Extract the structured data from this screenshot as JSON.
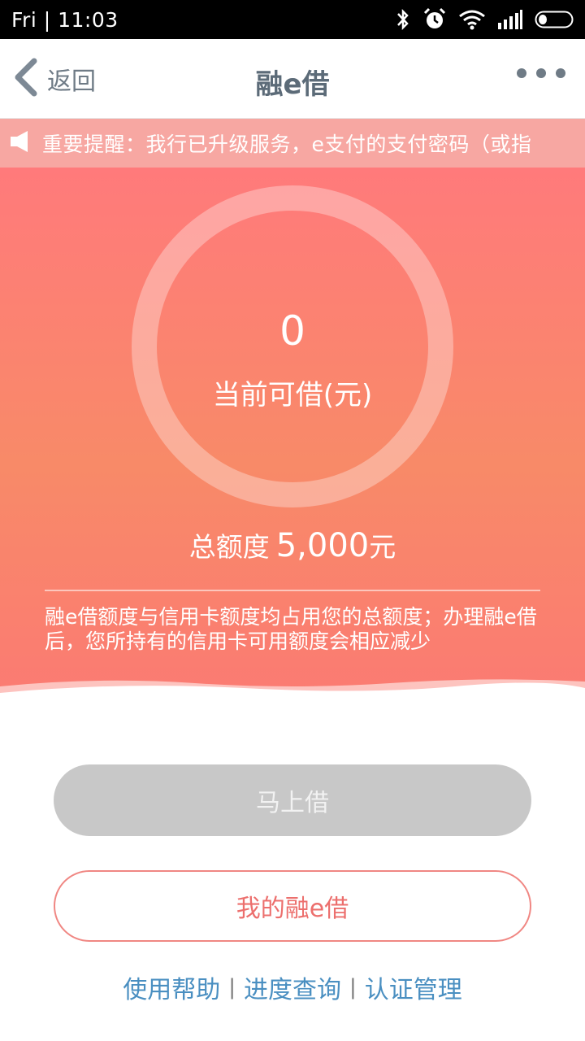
{
  "status_bar": {
    "time": "Fri | 11:03"
  },
  "nav": {
    "back_label": "返回",
    "title": "融e借"
  },
  "notice": {
    "text": "重要提醒：我行已升级服务，e支付的支付密码（或指"
  },
  "summary": {
    "available_amount": "0",
    "available_label": "当前可借(元)",
    "total_label": "总额度",
    "total_amount": "5,000",
    "total_unit": "元",
    "description": "融e借额度与信用卡额度均占用您的总额度；办理融e借后，您所持有的信用卡可用额度会相应减少"
  },
  "actions": {
    "borrow_label": "马上借",
    "my_loan_label": "我的融e借"
  },
  "links": {
    "help": "使用帮助",
    "progress": "进度查询",
    "auth": "认证管理",
    "separator": "|"
  },
  "colors": {
    "accent": "#ff7a7b",
    "link": "#4a8fc1",
    "disabled_button": "#c8c8c8"
  }
}
